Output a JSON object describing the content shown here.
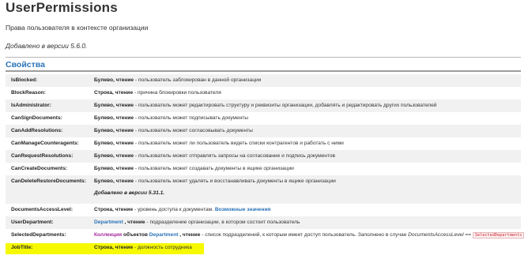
{
  "page": {
    "title": "UserPermissions",
    "description": "Права пользователя в контексте организации",
    "version_note": "Добавлено в версии 5.6.0."
  },
  "section": {
    "title": "Свойства"
  },
  "properties": [
    {
      "name": "IsBlocked:",
      "type": "Булево, чтение",
      "desc": " - пользователь заблокирован в данной организации"
    },
    {
      "name": "BlockReason:",
      "type": "Строка, чтение",
      "desc": " - причина блокировки пользователя"
    },
    {
      "name": "IsAdministrator:",
      "type": "Булево, чтение",
      "desc": " - пользователь может редактировать структуру и реквизиты организации, добавлять и редактировать других пользователей"
    },
    {
      "name": "CanSignDocuments:",
      "type": "Булево, чтение",
      "desc": " - пользователь может подписывать документы"
    },
    {
      "name": "CanAddResolutions:",
      "type": "Булево, чтение",
      "desc": " - пользователь может согласовывать документы"
    },
    {
      "name": "CanManageCounteragents:",
      "type": "Булево, чтение",
      "desc": " - пользователь может ли пользователь видеть списки контрагентов и работать с ними"
    },
    {
      "name": "CanRequestResolutions:",
      "type": "Булево, чтение",
      "desc": " - пользователь может отправлять запросы на согласование и подпись документов"
    },
    {
      "name": "CanCreateDocuments:",
      "type": "Булево, чтение",
      "desc": " - пользователь может создавать документы в ящике организации"
    },
    {
      "name": "CanDeleteRestoreDocuments:",
      "type": "Булево, чтение",
      "desc": " - пользователь может удалять и восстанавливать документы в ящике организации",
      "note": "Добавлено в версии 5.31.1."
    },
    {
      "name": "DocumentsAccessLevel:",
      "type": "Строка, чтение",
      "desc": " - уровень доступа к документам. ",
      "link": "Возможные значения"
    },
    {
      "name": "UserDepartment:",
      "link_first": "Department",
      "type": " , чтение",
      "desc": " - подразделение организации, в котором состоит пользователь"
    },
    {
      "name": "SelectedDepartments:",
      "collection": "Коллекция",
      "objects": " объектов ",
      "link": "Department",
      "type": " , чтение",
      "desc": " - список подразделений, к которым имеет доступ пользователь. Заполнено в случае ",
      "em": "DocumentsAccessLevel",
      "op": " == ",
      "code": "SelectedDepartments"
    },
    {
      "name": "JobTitle:",
      "type": "Строка, чтение",
      "desc": " - должность сотрудника"
    }
  ]
}
